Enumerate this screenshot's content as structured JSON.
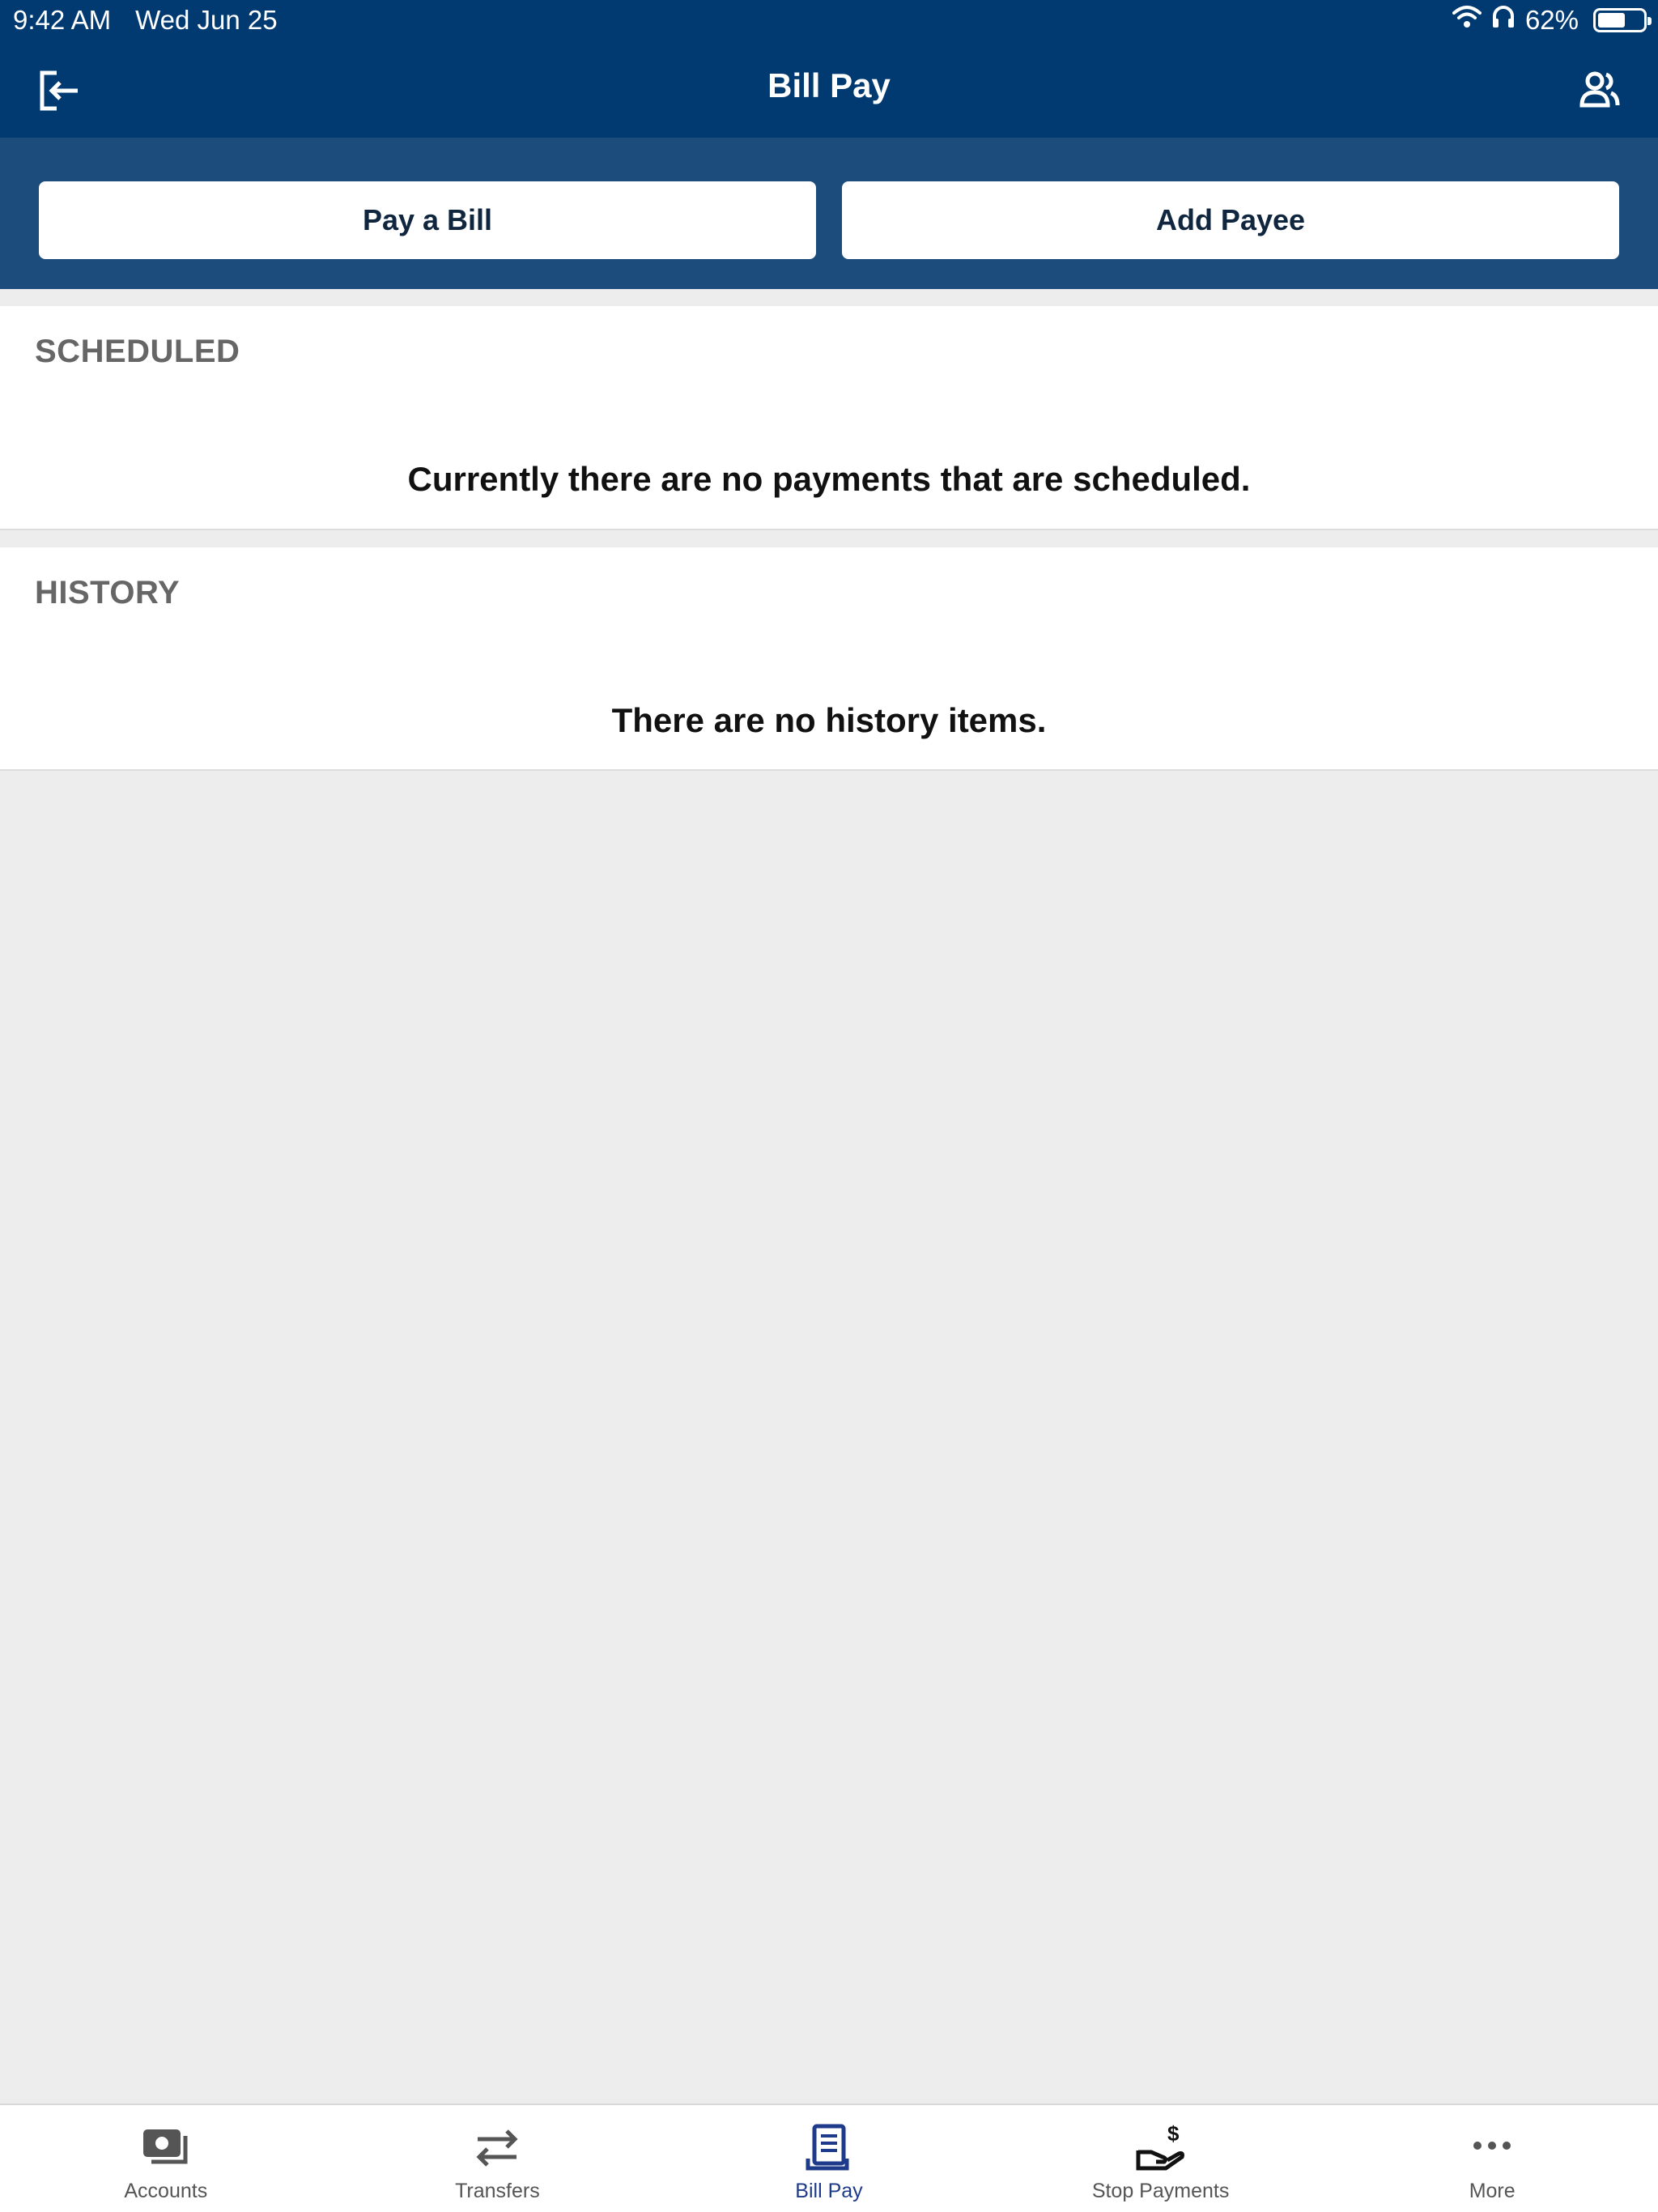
{
  "status_bar": {
    "time": "9:42 AM",
    "date": "Wed Jun 25",
    "battery_text": "62%",
    "battery_level": 0.62
  },
  "header": {
    "title": "Bill Pay",
    "left_icon": "sign-out-icon",
    "right_icon": "people-icon"
  },
  "actions": {
    "pay_bill_label": "Pay a Bill",
    "add_payee_label": "Add Payee"
  },
  "scheduled": {
    "heading": "SCHEDULED",
    "empty_text": "Currently there are no payments that are scheduled."
  },
  "history": {
    "heading": "HISTORY",
    "empty_text": "There are no history items."
  },
  "tabs": [
    {
      "label": "Accounts",
      "icon": "accounts-icon",
      "active": false
    },
    {
      "label": "Transfers",
      "icon": "transfers-icon",
      "active": false
    },
    {
      "label": "Bill Pay",
      "icon": "bill-pay-icon",
      "active": true
    },
    {
      "label": "Stop Payments",
      "icon": "stop-payments-icon",
      "active": false
    },
    {
      "label": "More",
      "icon": "more-icon",
      "active": false
    }
  ],
  "colors": {
    "header_bg": "#003a70",
    "action_band_bg": "#1b4c7c",
    "active_tab": "#1e3a8a",
    "page_bg": "#ededed"
  }
}
